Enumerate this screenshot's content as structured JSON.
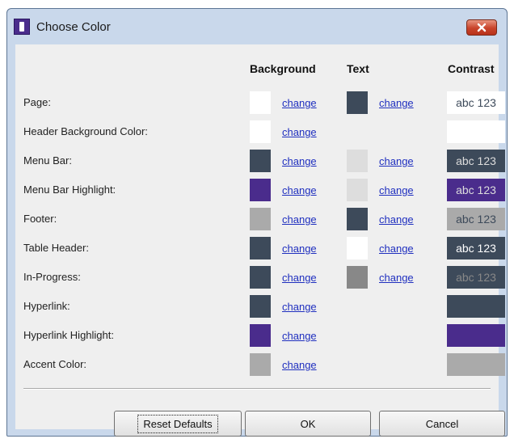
{
  "window": {
    "title": "Choose Color"
  },
  "columns": {
    "background": "Background",
    "text": "Text",
    "contrast": "Contrast"
  },
  "change_label": "change",
  "rows": [
    {
      "label": "Page:",
      "bg": "#ffffff",
      "text": "#3d4a5a",
      "contrast_text": "abc 123",
      "contrast_fg": "#3d4a5a"
    },
    {
      "label": "Header Background Color:",
      "bg": "#ffffff",
      "text": null,
      "contrast_text": "",
      "contrast_fg": ""
    },
    {
      "label": "Menu Bar:",
      "bg": "#3d4a5a",
      "text": "#dddddd",
      "contrast_text": "abc 123",
      "contrast_fg": "#dddddd"
    },
    {
      "label": "Menu Bar Highlight:",
      "bg": "#4a2c8c",
      "text": "#dddddd",
      "contrast_text": "abc 123",
      "contrast_fg": "#dddddd"
    },
    {
      "label": "Footer:",
      "bg": "#aaaaaa",
      "text": "#3d4a5a",
      "contrast_text": "abc 123",
      "contrast_fg": "#3d4a5a"
    },
    {
      "label": "Table Header:",
      "bg": "#3d4a5a",
      "text": "#ffffff",
      "contrast_text": "abc 123",
      "contrast_fg": "#ffffff"
    },
    {
      "label": "In-Progress:",
      "bg": "#3d4a5a",
      "text": "#888888",
      "contrast_text": "abc 123",
      "contrast_fg": "#888888"
    },
    {
      "label": "Hyperlink:",
      "bg": "#3d4a5a",
      "text": null,
      "contrast_text": "",
      "contrast_fg": ""
    },
    {
      "label": "Hyperlink Highlight:",
      "bg": "#4a2c8c",
      "text": null,
      "contrast_text": "",
      "contrast_fg": ""
    },
    {
      "label": "Accent Color:",
      "bg": "#aaaaaa",
      "text": null,
      "contrast_text": "",
      "contrast_fg": ""
    }
  ],
  "buttons": {
    "reset": "Reset Defaults",
    "ok": "OK",
    "cancel": "Cancel"
  }
}
